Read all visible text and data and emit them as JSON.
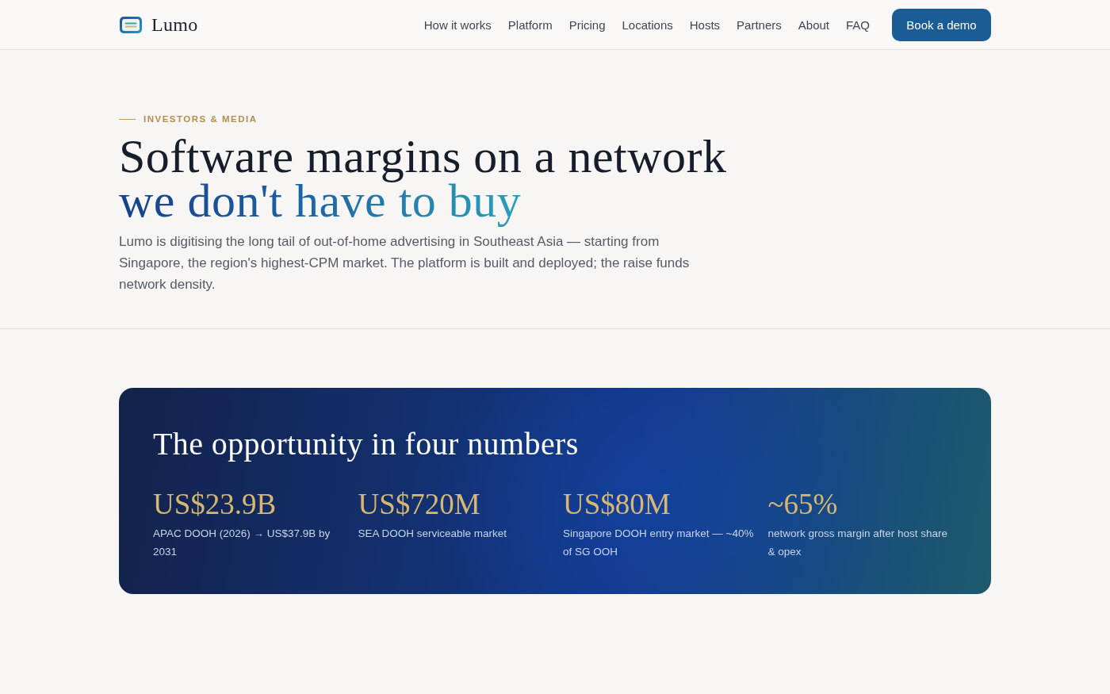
{
  "nav": {
    "brand": "Lumo",
    "links": [
      "How it works",
      "Platform",
      "Pricing",
      "Locations",
      "Hosts",
      "Partners",
      "About",
      "FAQ"
    ],
    "cta": "Book a demo"
  },
  "hero": {
    "eyebrow": "INVESTORS & MEDIA",
    "title": "Software margins on a network",
    "title_highlight": "we don't have to buy",
    "lead": "Lumo is digitising the long tail of out-of-home advertising in Southeast Asia — starting from Singapore, the region's highest-CPM market. The platform is built and deployed; the raise funds network density."
  },
  "opportunity": {
    "title": "The opportunity in four numbers",
    "stats": [
      {
        "value": "US$23.9B",
        "label": "APAC DOOH (2026) → US$37.9B by 2031"
      },
      {
        "value": "US$720M",
        "label": "SEA DOOH serviceable market"
      },
      {
        "value": "US$80M",
        "label": "Singapore DOOH entry market — ~40% of SG OOH"
      },
      {
        "value": "~65%",
        "label": "network gross margin after host share & opex"
      }
    ]
  }
}
